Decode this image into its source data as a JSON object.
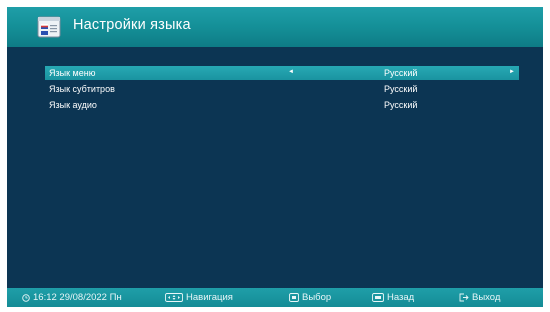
{
  "header": {
    "title": "Настройки языка",
    "icon": "language-settings-icon"
  },
  "menu": [
    {
      "label": "Язык меню",
      "value": "Русский",
      "selected": true
    },
    {
      "label": "Язык субтитров",
      "value": "Русский",
      "selected": false
    },
    {
      "label": "Язык аудио",
      "value": "Русский",
      "selected": false
    }
  ],
  "footer": {
    "time": "16:12",
    "date": "29/08/2022",
    "weekday": "Пн",
    "navigation": "Навигация",
    "select": "Выбор",
    "back": "Назад",
    "exit": "Выход"
  },
  "colors": {
    "background": "#0c3553",
    "accent": "#1c9aa6",
    "text": "#ffffff"
  }
}
